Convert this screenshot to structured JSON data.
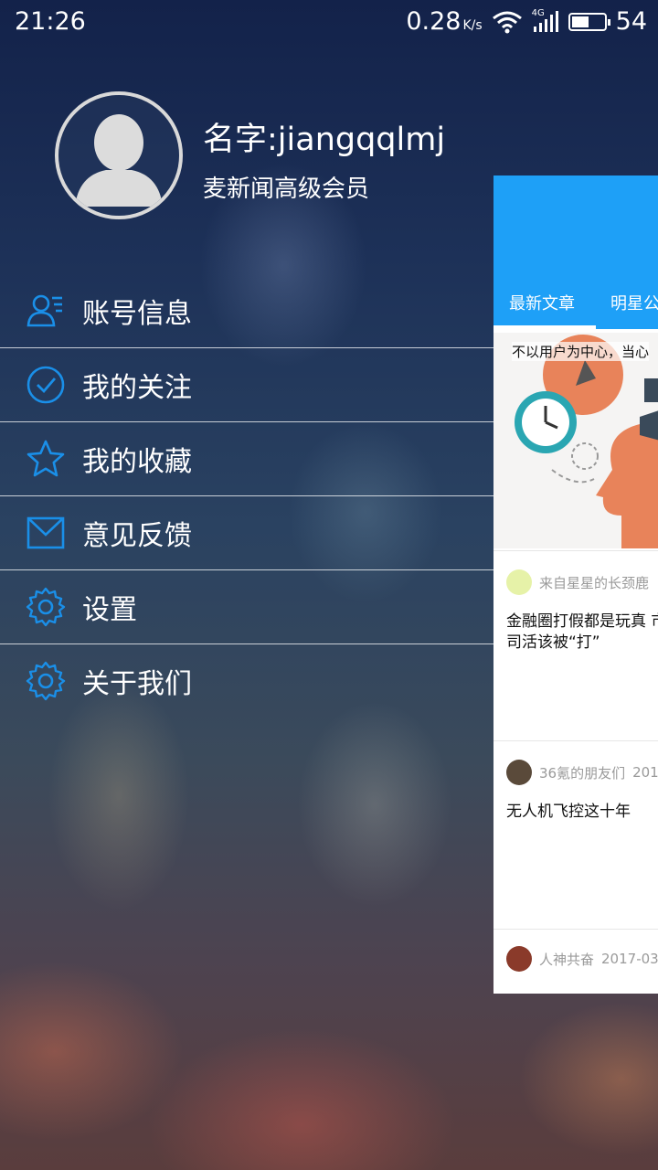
{
  "status_bar": {
    "time": "21:26",
    "net_speed": "0.28",
    "net_speed_unit": "K/s",
    "network_type": "4G",
    "battery_level": "54",
    "icons": [
      "wifi-icon",
      "signal-icon",
      "battery-icon"
    ]
  },
  "profile": {
    "name": "名字:jiangqqlmj",
    "level": "麦新闻高级会员"
  },
  "menu": {
    "items": [
      {
        "label": "账号信息",
        "icon": "account-info-icon"
      },
      {
        "label": "我的关注",
        "icon": "check-circle-icon"
      },
      {
        "label": "我的收藏",
        "icon": "star-icon"
      },
      {
        "label": "意见反馈",
        "icon": "mail-icon"
      },
      {
        "label": "设置",
        "icon": "gear-icon"
      },
      {
        "label": "关于我们",
        "icon": "gear-icon"
      }
    ]
  },
  "content": {
    "tabs": [
      "最新文章",
      "明星公"
    ],
    "banner_caption": "不以用户为中心，当心",
    "articles": [
      {
        "source": "来自星星的长颈鹿",
        "date": "",
        "title": "金融圈打假都是玩真 市公司活该被“打”"
      },
      {
        "source": "36氪的朋友们",
        "date": "201",
        "title": "无人机飞控这十年"
      },
      {
        "source": "人神共奋",
        "date": "2017-03",
        "title": ""
      }
    ]
  },
  "colors": {
    "accent": "#1ea0f7",
    "menu_icon": "#1a8fe8"
  }
}
